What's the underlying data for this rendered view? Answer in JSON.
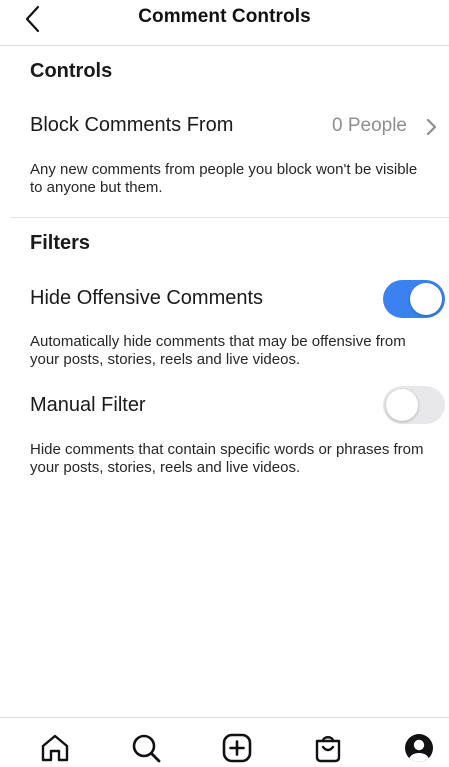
{
  "header": {
    "title": "Comment Controls",
    "back_icon": "chevron-left-icon"
  },
  "controls": {
    "section_title": "Controls",
    "block_comments": {
      "label": "Block Comments From",
      "value": "0 People",
      "chevron_icon": "chevron-right-icon"
    },
    "description": "Any new comments from people you block won't be visible to anyone but them."
  },
  "filters": {
    "section_title": "Filters",
    "hide_offensive": {
      "label": "Hide Offensive Comments",
      "enabled": true,
      "description": "Automatically hide comments that may be offensive from your posts, stories, reels and live videos."
    },
    "manual_filter": {
      "label": "Manual Filter",
      "enabled": false,
      "description": "Hide comments that contain specific words or phrases from your posts, stories, reels and live videos."
    }
  },
  "tabbar": {
    "items": [
      {
        "icon": "home-icon"
      },
      {
        "icon": "search-icon"
      },
      {
        "icon": "add-post-icon"
      },
      {
        "icon": "shop-bag-icon"
      },
      {
        "icon": "profile-icon"
      }
    ]
  },
  "colors": {
    "toggle_on": "#3b82f0",
    "toggle_off": "#e8e8ea",
    "secondary_text": "#8e8e8e"
  }
}
